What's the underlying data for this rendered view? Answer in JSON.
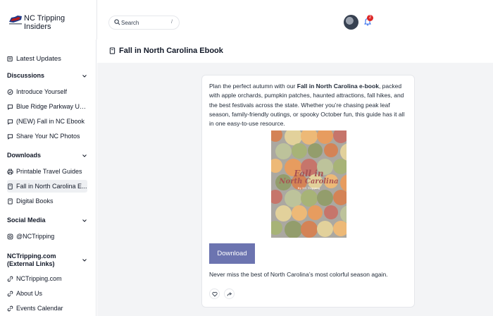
{
  "header": {
    "brand": "NC Tripping Insiders",
    "search_placeholder": "Search",
    "search_shortcut": "/",
    "notification_count": "2"
  },
  "sidebar": {
    "latest_updates": "Latest Updates",
    "sections": [
      {
        "label": "Discussions",
        "items": [
          "Introduce Yourself",
          "Blue Ridge Parkway Up...",
          "(NEW) Fall in NC Ebook",
          "Share Your NC Photos"
        ]
      },
      {
        "label": "Downloads",
        "items": [
          "Printable Travel Guides",
          "Fall in North Carolina E...",
          "Digital Books"
        ]
      },
      {
        "label": "Social Media",
        "items": [
          "@NCTripping"
        ]
      },
      {
        "label": "NCTripping.com (External Links)",
        "items": [
          "NCTripping.com",
          "About Us",
          "Events Calendar"
        ]
      }
    ]
  },
  "page": {
    "title": "Fall in North Carolina Ebook",
    "intro_before": "Plan the perfect autumn with our ",
    "intro_bold": "Fall in North Carolina e-book",
    "intro_after": ", packed with apple orchards, pumpkin patches, haunted attractions, fall hikes, and the best festivals across the state. Whether you’re chasing peak leaf season, family-friendly outings, or spooky October fun, this guide has it all in one easy-to-use resource.",
    "cover_line1": "Fall in",
    "cover_line2": "North Carolina",
    "cover_line3": "By NC Tripping",
    "download_label": "Download",
    "tagline": "Never miss the best of North Carolina’s most colorful season again."
  },
  "colors": {
    "accent": "#6c74b0",
    "badge": "#dc2626",
    "main_bg": "#f3f4f6"
  }
}
